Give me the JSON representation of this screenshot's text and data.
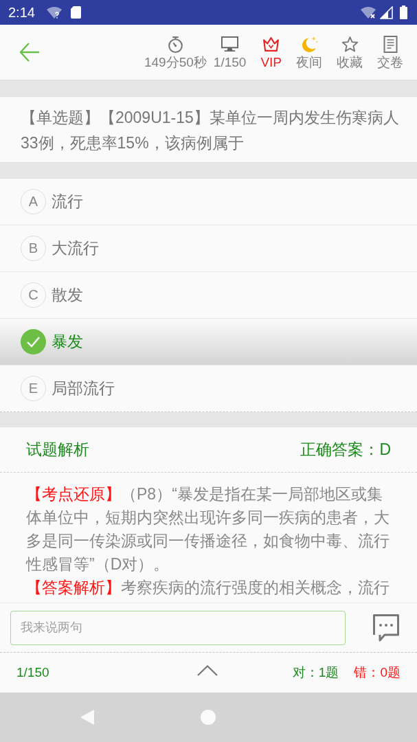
{
  "status_bar": {
    "time": "2:14"
  },
  "toolbar": {
    "items": [
      {
        "kind": "timer",
        "label": "149分50秒"
      },
      {
        "kind": "count",
        "label": "1/150"
      },
      {
        "kind": "vip",
        "label": "VIP"
      },
      {
        "kind": "night",
        "label": "夜间"
      },
      {
        "kind": "favorite",
        "label": "收藏"
      },
      {
        "kind": "submit",
        "label": "交卷"
      }
    ]
  },
  "question": {
    "text": "【单选题】【2009U1-15】某单位一周内发生伤寒病人33例，死患率15%，该病例属于"
  },
  "options": [
    {
      "letter": "A",
      "text": "流行",
      "selected": false
    },
    {
      "letter": "B",
      "text": "大流行",
      "selected": false
    },
    {
      "letter": "C",
      "text": "散发",
      "selected": false
    },
    {
      "text": "暴发",
      "selected": true
    },
    {
      "letter": "E",
      "text": "局部流行",
      "selected": false
    }
  ],
  "analysis": {
    "title": "试题解析",
    "answer": "正确答案：D",
    "paragraphs": [
      {
        "tag": "【考点还原】",
        "text": "（P8）“暴发是指在某一局部地区或集体单位中，短期内突然出现许多同一疾病的患者，大多是同一传染源或同一传播途径，如食物中毒、流行性感冒等”（D对）。"
      },
      {
        "tag": "【答案解析】",
        "text": "考察疾病的流行强度的相关概念，流行"
      }
    ]
  },
  "comment": {
    "placeholder": "我来说两句"
  },
  "footer": {
    "progress": "1/150",
    "correct": "对：1题",
    "wrong": "错：0题"
  }
}
